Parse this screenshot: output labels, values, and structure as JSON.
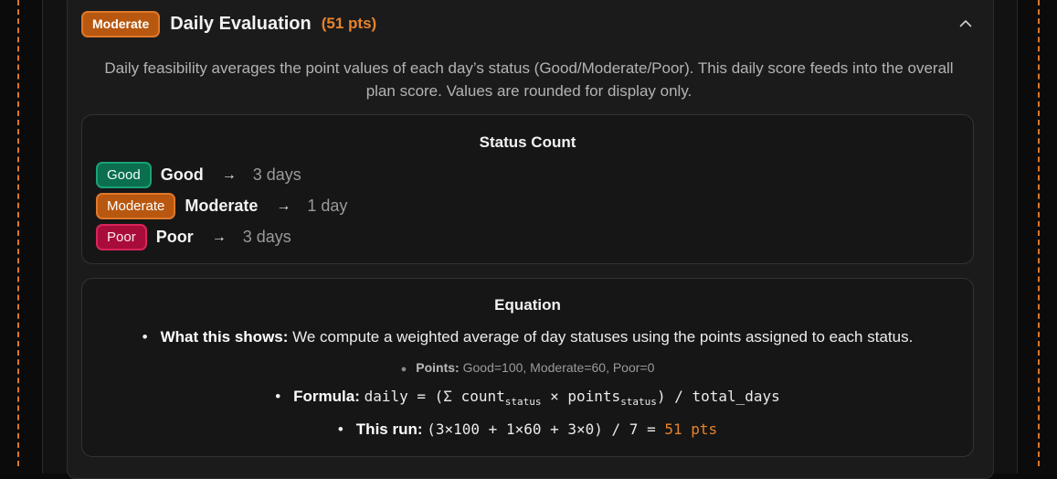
{
  "header": {
    "badge": "Moderate",
    "title": "Daily Evaluation",
    "points": "(51 pts)"
  },
  "description": "Daily feasibility averages the point values of each day’s status (Good/Moderate/Poor). This daily score feeds into the overall plan score. Values are rounded for display only.",
  "status_count": {
    "title": "Status Count",
    "rows": [
      {
        "badge": "Good",
        "name": "Good",
        "arrow": "→",
        "days": "3 days"
      },
      {
        "badge": "Moderate",
        "name": "Moderate",
        "arrow": "→",
        "days": "1 day"
      },
      {
        "badge": "Poor",
        "name": "Poor",
        "arrow": "→",
        "days": "3 days"
      }
    ]
  },
  "equation": {
    "title": "Equation",
    "what_label": "What this shows:",
    "what_text": "We compute a weighted average of day statuses using the points assigned to each status.",
    "points_label": "Points:",
    "points_text": "Good=100, Moderate=60, Poor=0",
    "formula_label": "Formula:",
    "formula_prefix": "daily = (Σ count",
    "formula_sub1": "status",
    "formula_mid": " × points",
    "formula_sub2": "status",
    "formula_suffix": ") / total_days",
    "run_label": "This run:",
    "run_expr": "(3×100 + 1×60 + 3×0) / 7 = ",
    "run_result": "51 pts"
  },
  "icons": {
    "collapse": "chevron-up-icon"
  },
  "colors": {
    "accent_orange": "#e8832b",
    "good": "#0a6e4f",
    "moderate": "#b8570f",
    "poor": "#a80d3a",
    "dashed_border": "#d9772b"
  }
}
